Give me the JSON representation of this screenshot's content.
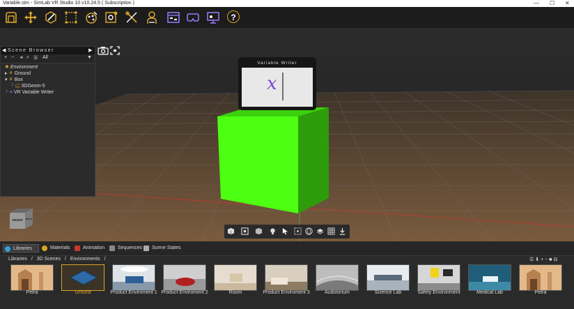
{
  "window": {
    "title": "Variable.sim - SimLab VR Studio 10 v10.24.5 ( Subscription )",
    "minimize": "—",
    "maximize": "☐",
    "close": "✕"
  },
  "toolbar": {
    "icons": [
      "open-file-icon",
      "move-icon",
      "edit-geometry-icon",
      "bounding-box-icon",
      "materials-icon",
      "image-settings-icon",
      "tools-icon",
      "person-icon",
      "vr-logic-icon",
      "vr-headset-icon",
      "presentation-icon",
      "help-icon"
    ],
    "help_label": "?"
  },
  "scene_browser": {
    "title": "Scene Browser",
    "filter_value": "All",
    "items": [
      {
        "label": "Environment"
      },
      {
        "label": "Ground"
      },
      {
        "label": "Box"
      },
      {
        "label": "3DGeom-5"
      },
      {
        "label": "VR Variable Writer"
      }
    ]
  },
  "viewport": {
    "panel_title": "Variable Writer",
    "panel_variable": "x",
    "cube_labels": {
      "front": "FRONT",
      "right": "RIGHT"
    },
    "colors": {
      "cube_front": "#4dff10",
      "cube_side": "#2d9c0a",
      "cube_top": "#3ad10c",
      "floor": "#6b5138",
      "sky": "#262626"
    }
  },
  "bottom_panel": {
    "tabs": [
      "Libraries",
      "Materials",
      "Animation",
      "Sequences",
      "Scene States"
    ],
    "breadcrumb": [
      "Libraries",
      "3D Scenes",
      "Environments"
    ],
    "library_items": [
      {
        "label": "Petra"
      },
      {
        "label": "Ground"
      },
      {
        "label": "Product Enviroment 1"
      },
      {
        "label": "Product Enviroment 2"
      },
      {
        "label": "Room"
      },
      {
        "label": "Product Enviroment 3"
      },
      {
        "label": "Audotorium"
      },
      {
        "label": "Science Lab"
      },
      {
        "label": "Safety Environment"
      },
      {
        "label": "Medical Lab"
      },
      {
        "label": "Petra"
      }
    ],
    "selected_item": "Ground",
    "accent": "#d9a42a"
  }
}
